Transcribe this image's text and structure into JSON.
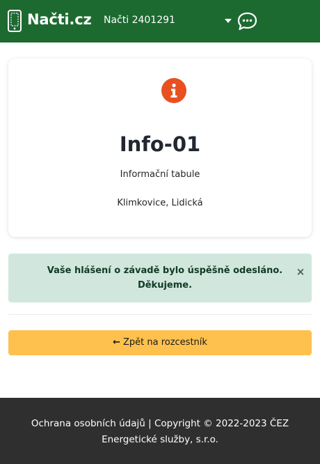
{
  "header": {
    "brand": "Načti.cz",
    "selector_label": "Načti 2401291",
    "logo_icon": "phone-icon",
    "caret_icon": "caret-down-icon",
    "chat_icon": "chat-bubble-icon"
  },
  "card": {
    "icon": "info-icon",
    "title": "Info-01",
    "type": "Informační tabule",
    "location": "Klimkovice, Lidická"
  },
  "alert": {
    "line1": "Vaše hlášení o závadě bylo úspěšně odesláno.",
    "line2": "Děkujeme.",
    "close_label": "×"
  },
  "back_button": {
    "arrow": "←",
    "label": "Zpět na rozcestník"
  },
  "footer": {
    "privacy_link": "Ochrana osobních údajů",
    "separator": "|",
    "copyright_line1": "Copyright © 2022-2023 ČEZ",
    "copyright_line2": "Energetické služby, s.r.o."
  },
  "colors": {
    "header_bg": "#1d6a31",
    "info_icon": "#e8511f",
    "alert_bg": "#d1e7dd",
    "button_bg": "#fec14e",
    "footer_bg": "#2f2f2f"
  }
}
